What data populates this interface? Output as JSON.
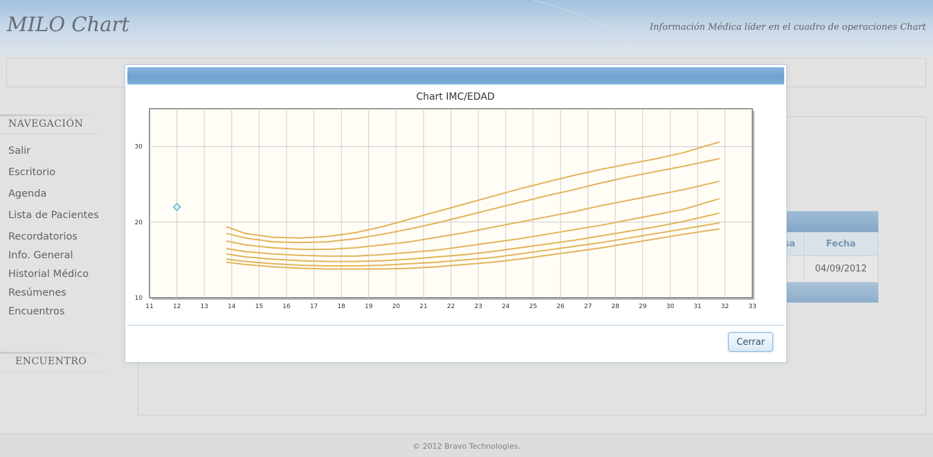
{
  "header": {
    "app_title": "MILO Chart",
    "tagline": "Información Médica líder en el cuadro de operaciones Chart"
  },
  "sidebar": {
    "nav_heading": "NAVEGACIÓN",
    "items": [
      {
        "label": "Salir"
      },
      {
        "label": "Escritorio"
      },
      {
        "label": "Agenda"
      },
      {
        "label": "Lista de Pacientes"
      },
      {
        "label": "Recordatorios"
      },
      {
        "label": "Info. General"
      },
      {
        "label": "Historial Médico"
      },
      {
        "label": "Resúmenes"
      },
      {
        "label": "Encuentros"
      }
    ],
    "encounter_heading": "ENCUENTRO"
  },
  "background_table": {
    "col1_header": "sa",
    "col2_header": "Fecha",
    "row_date": "04/09/2012"
  },
  "footer": {
    "copyright": "© 2012 Bravo Technologies."
  },
  "dialog": {
    "close_label": "Cerrar"
  },
  "colors": {
    "curve": "#e2b45a",
    "marker": "#5fb6c9",
    "plot_bg": "#fffdf5",
    "grid": "#cccccc"
  },
  "chart_data": {
    "type": "line",
    "title": "Chart IMC/EDAD",
    "xlabel": "",
    "ylabel": "",
    "xlim": [
      11,
      33
    ],
    "ylim": [
      10,
      35
    ],
    "xticks": [
      11,
      12,
      13,
      14,
      15,
      16,
      17,
      18,
      19,
      20,
      21,
      22,
      23,
      24,
      25,
      26,
      27,
      28,
      29,
      30,
      31,
      32,
      33
    ],
    "yticks": [
      10,
      20,
      30
    ],
    "grid": true,
    "series": [
      {
        "x": [
          13.8,
          14.5,
          15.5,
          16.5,
          17.5,
          18.5,
          19.5,
          20.5,
          21.5,
          22.5,
          23.5,
          24.5,
          25.5,
          26.5,
          27.5,
          28.5,
          29.5,
          30.5,
          31.8
        ],
        "y": [
          19.4,
          18.5,
          18.0,
          17.9,
          18.1,
          18.6,
          19.4,
          20.4,
          21.4,
          22.4,
          23.4,
          24.4,
          25.3,
          26.2,
          27.0,
          27.7,
          28.4,
          29.2,
          30.6
        ]
      },
      {
        "x": [
          13.8,
          14.5,
          15.5,
          16.5,
          17.5,
          18.5,
          19.5,
          20.5,
          21.5,
          22.5,
          23.5,
          24.5,
          25.5,
          26.5,
          27.5,
          28.5,
          29.5,
          30.5,
          31.8
        ],
        "y": [
          18.5,
          17.9,
          17.4,
          17.3,
          17.4,
          17.8,
          18.4,
          19.1,
          19.9,
          20.8,
          21.7,
          22.6,
          23.5,
          24.3,
          25.2,
          26.0,
          26.7,
          27.4,
          28.4
        ]
      },
      {
        "x": [
          13.8,
          14.5,
          15.5,
          16.5,
          17.5,
          18.5,
          19.5,
          20.5,
          21.5,
          22.5,
          23.5,
          24.5,
          25.5,
          26.5,
          27.5,
          28.5,
          29.5,
          30.5,
          31.8
        ],
        "y": [
          17.5,
          17.0,
          16.6,
          16.4,
          16.4,
          16.6,
          17.0,
          17.4,
          18.0,
          18.6,
          19.3,
          20.0,
          20.7,
          21.4,
          22.2,
          22.9,
          23.6,
          24.3,
          25.4
        ]
      },
      {
        "x": [
          13.8,
          14.5,
          15.5,
          16.5,
          17.5,
          18.5,
          19.5,
          20.5,
          21.5,
          22.5,
          23.5,
          24.5,
          25.5,
          26.5,
          27.5,
          28.5,
          29.5,
          30.5,
          31.8
        ],
        "y": [
          16.5,
          16.1,
          15.8,
          15.6,
          15.5,
          15.5,
          15.7,
          16.0,
          16.3,
          16.8,
          17.3,
          17.8,
          18.4,
          19.0,
          19.6,
          20.3,
          21.0,
          21.7,
          23.1
        ]
      },
      {
        "x": [
          13.8,
          14.5,
          15.5,
          16.5,
          17.5,
          18.5,
          19.5,
          20.5,
          21.5,
          22.5,
          23.5,
          24.5,
          25.5,
          26.5,
          27.5,
          28.5,
          29.5,
          30.5,
          31.8
        ],
        "y": [
          15.8,
          15.4,
          15.1,
          14.9,
          14.8,
          14.8,
          14.9,
          15.1,
          15.4,
          15.7,
          16.1,
          16.6,
          17.1,
          17.6,
          18.2,
          18.8,
          19.4,
          20.1,
          21.2
        ]
      },
      {
        "x": [
          13.8,
          14.5,
          15.5,
          16.5,
          17.5,
          18.5,
          19.5,
          20.5,
          21.5,
          22.5,
          23.5,
          24.5,
          25.5,
          26.5,
          27.5,
          28.5,
          29.5,
          30.5,
          31.8
        ],
        "y": [
          15.1,
          14.8,
          14.5,
          14.3,
          14.2,
          14.2,
          14.3,
          14.5,
          14.7,
          15.0,
          15.3,
          15.8,
          16.3,
          16.8,
          17.3,
          17.9,
          18.5,
          19.1,
          19.9
        ]
      },
      {
        "x": [
          13.8,
          14.5,
          15.5,
          16.5,
          17.5,
          18.5,
          19.5,
          20.5,
          21.5,
          22.5,
          23.5,
          24.5,
          25.5,
          26.5,
          27.5,
          28.5,
          29.5,
          30.5,
          31.8
        ],
        "y": [
          14.7,
          14.4,
          14.1,
          13.9,
          13.8,
          13.8,
          13.8,
          13.9,
          14.1,
          14.4,
          14.7,
          15.1,
          15.6,
          16.1,
          16.6,
          17.2,
          17.8,
          18.4,
          19.1
        ]
      }
    ],
    "points": [
      {
        "x": 12,
        "y": 22
      }
    ]
  }
}
